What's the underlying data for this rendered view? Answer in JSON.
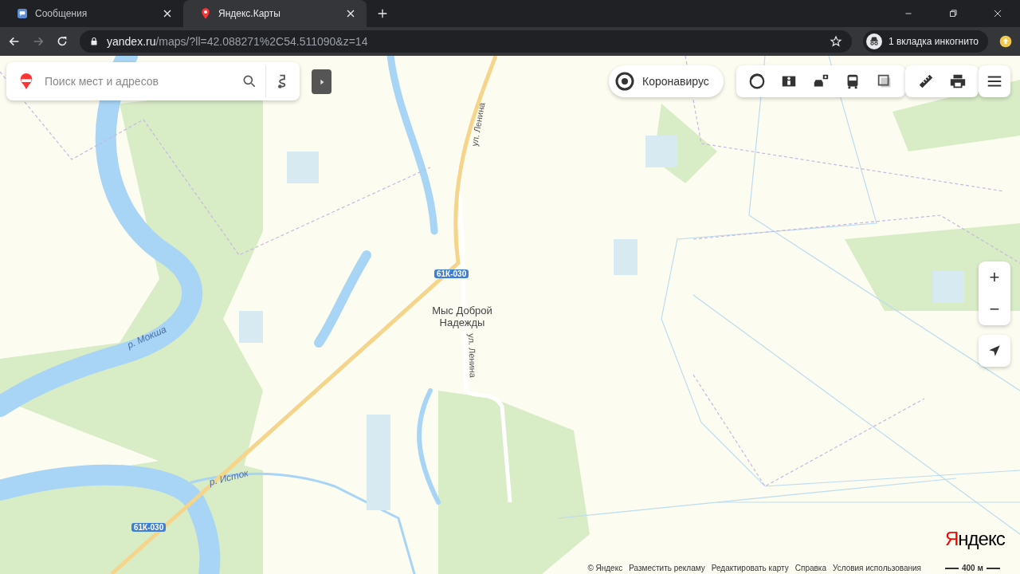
{
  "browser": {
    "tabs": [
      {
        "title": "Сообщения",
        "kind": "messages",
        "selected": false
      },
      {
        "title": "Яндекс.Карты",
        "kind": "pin",
        "selected": true
      }
    ],
    "address": {
      "host": "yandex.ru",
      "path": "/maps/?ll=42.088271%2C54.511090&z=14"
    },
    "incognito": "1 вкладка инкогнито"
  },
  "search": {
    "placeholder": "Поиск мест и адресов"
  },
  "covid_button": "Коронавирус",
  "map_labels": [
    {
      "text": "ул. Ленина",
      "kind": "street"
    },
    {
      "text": "ул. Ленина",
      "kind": "street"
    },
    {
      "text": "61К-030",
      "kind": "road"
    },
    {
      "text": "61К-030",
      "kind": "road"
    },
    {
      "text": "Мыс Доброй Надежды",
      "kind": "place"
    },
    {
      "text": "р. Мокша",
      "kind": "river"
    },
    {
      "text": "р. Исток",
      "kind": "river"
    }
  ],
  "logo": "Яндекс",
  "footer_links": [
    "© Яндекс",
    "Разместить рекламу",
    "Редактировать карту",
    "Справка",
    "Условия использования"
  ],
  "scale": "400 м",
  "zoom_buttons": [
    "+",
    "−"
  ]
}
